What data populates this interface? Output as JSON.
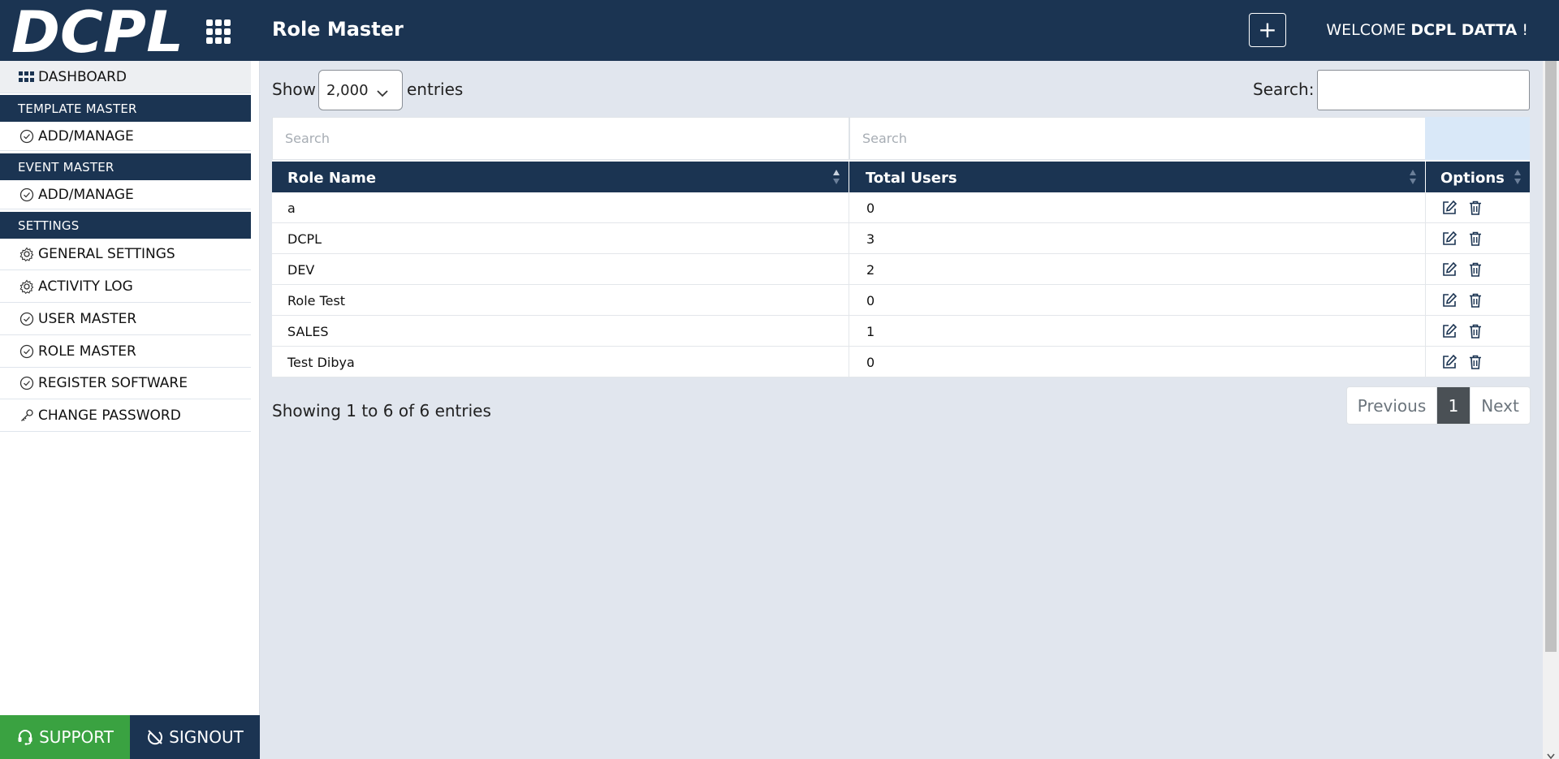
{
  "header": {
    "logo_text": "DCPL",
    "title": "Role Master",
    "add_label": "+",
    "welcome_prefix": "WELCOME",
    "user_name": "DCPL DATTA",
    "welcome_suffix": "!"
  },
  "sidebar": {
    "dashboard": "DASHBOARD",
    "sections": [
      {
        "heading": "TEMPLATE MASTER",
        "items": [
          "ADD/MANAGE"
        ]
      },
      {
        "heading": "EVENT MASTER",
        "items": [
          "ADD/MANAGE"
        ]
      },
      {
        "heading": "SETTINGS",
        "items": [
          "GENERAL SETTINGS",
          "ACTIVITY LOG",
          "USER MASTER",
          "ROLE MASTER",
          "REGISTER SOFTWARE",
          "CHANGE PASSWORD"
        ]
      }
    ],
    "support": "SUPPORT",
    "signout": "SIGNOUT"
  },
  "controls": {
    "show_label": "Show",
    "length_value": "2,000",
    "entries_label": "entries",
    "search_label": "Search:",
    "search_value": ""
  },
  "table": {
    "filter_placeholders": [
      "Search",
      "Search"
    ],
    "columns": [
      "Role Name",
      "Total Users",
      "Options"
    ],
    "rows": [
      {
        "role": "a",
        "users": "0"
      },
      {
        "role": "DCPL",
        "users": "3"
      },
      {
        "role": "DEV",
        "users": "2"
      },
      {
        "role": "Role Test",
        "users": "0"
      },
      {
        "role": "SALES",
        "users": "1"
      },
      {
        "role": "Test Dibya",
        "users": "0"
      }
    ]
  },
  "footer": {
    "info": "Showing 1 to 6 of 6 entries",
    "prev": "Previous",
    "current_page": "1",
    "next": "Next"
  },
  "colors": {
    "navy": "#1b3452",
    "support_green": "#3aa241",
    "page_bg": "#e1e6ee"
  }
}
